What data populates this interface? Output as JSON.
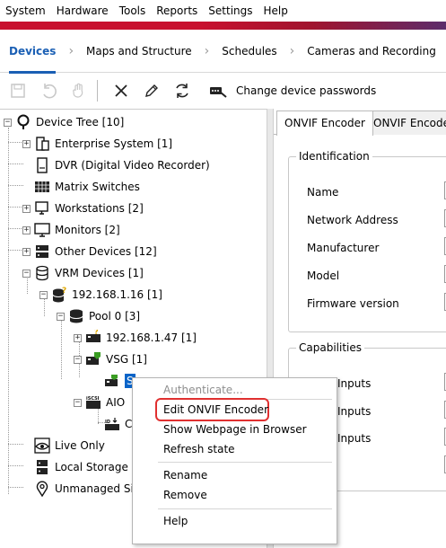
{
  "menubar": [
    "System",
    "Hardware",
    "Tools",
    "Reports",
    "Settings",
    "Help"
  ],
  "nav_tabs": [
    "Devices",
    "Maps and Structure",
    "Schedules",
    "Cameras and Recording"
  ],
  "toolbar": {
    "change_passwords_label": "Change device passwords"
  },
  "tree": {
    "root": "Device Tree [10]",
    "items": [
      "Enterprise System [1]",
      "DVR (Digital Video Recorder)",
      "Matrix Switches",
      "Workstations [2]",
      "Monitors [2]",
      "Other Devices [12]",
      "VRM Devices [1]",
      "192.168.1.16 [1]",
      "Pool 0 [3]",
      "192.168.1.47 [1]",
      "VSG [1]",
      "S",
      "AIO",
      "C",
      "Live Only",
      "Local Storage",
      "Unmanaged Site"
    ]
  },
  "right": {
    "tabs": [
      "ONVIF Encoder",
      "ONVIF Encoder"
    ],
    "identification": {
      "title": "Identification",
      "fields": [
        "Name",
        "Network Address",
        "Manufacturer",
        "Model",
        "Firmware version"
      ]
    },
    "capabilities": {
      "title": "Capabilities",
      "fields": [
        "Inputs",
        "Inputs",
        "Inputs"
      ]
    }
  },
  "context_menu": {
    "items": [
      "Authenticate...",
      "Edit ONVIF Encoder",
      "Show Webpage in Browser",
      "Refresh state",
      "Rename",
      "Remove",
      "Help"
    ]
  },
  "colors": {
    "accent": "#1a5fb4",
    "brand": "#c8102e",
    "selection": "#0a64c8",
    "highlight_outline": "#e03030"
  }
}
